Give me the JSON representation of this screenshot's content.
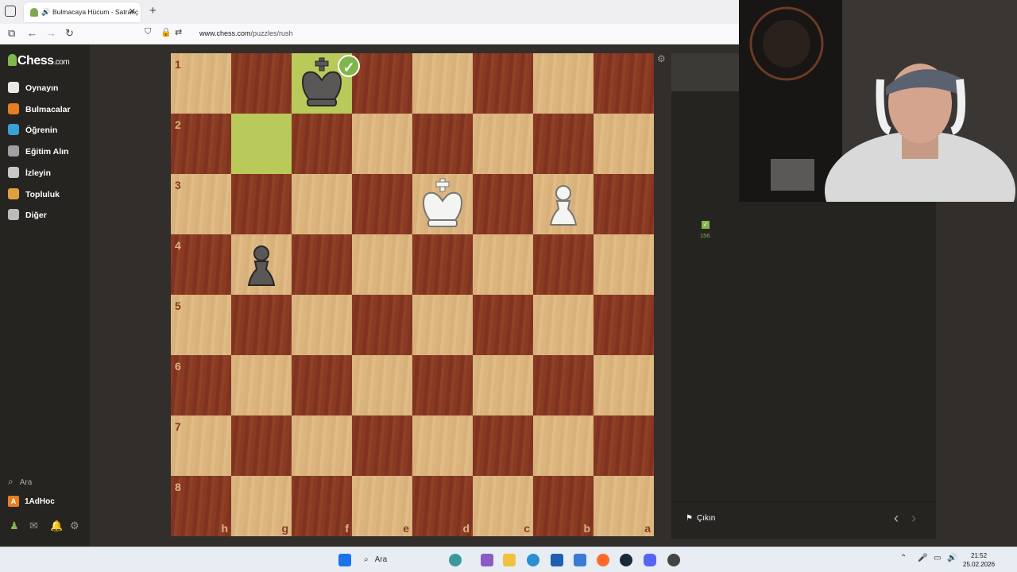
{
  "browser": {
    "tab_title": "Bulmacaya Hücum - Satranç",
    "url_host": "www.chess.com",
    "url_path": "/puzzles/rush"
  },
  "sidebar": {
    "logo": "Chess",
    "logo_suffix": ".com",
    "items": [
      {
        "label": "Oynayın",
        "icon": "play-icon",
        "color": "#e8e8e8"
      },
      {
        "label": "Bulmacalar",
        "icon": "puzzle-icon",
        "color": "#e67e22"
      },
      {
        "label": "Öğrenin",
        "icon": "learn-icon",
        "color": "#3aa0d8"
      },
      {
        "label": "Eğitim Alın",
        "icon": "coach-icon",
        "color": "#a0a0a0"
      },
      {
        "label": "İzleyin",
        "icon": "watch-icon",
        "color": "#c8c8c8"
      },
      {
        "label": "Topluluk",
        "icon": "community-icon",
        "color": "#e0a040"
      },
      {
        "label": "Diğer",
        "icon": "more-icon",
        "color": "#bbbbbb"
      }
    ],
    "search_label": "Ara",
    "username": "1AdHoc",
    "avatar_letter": "A"
  },
  "board": {
    "orientation": "black",
    "ranks": [
      "1",
      "2",
      "3",
      "4",
      "5",
      "6",
      "7",
      "8"
    ],
    "files": [
      "h",
      "g",
      "f",
      "e",
      "d",
      "c",
      "b",
      "a"
    ],
    "highlighted": [
      "f1",
      "g2"
    ],
    "pieces": [
      {
        "square": "f1",
        "type": "king",
        "color": "black"
      },
      {
        "square": "d3",
        "type": "king",
        "color": "white"
      },
      {
        "square": "b3",
        "type": "pawn",
        "color": "white"
      },
      {
        "square": "g4",
        "type": "pawn",
        "color": "black"
      }
    ],
    "move_status": "correct"
  },
  "panel": {
    "score": "156",
    "quit_label": "Çıkın"
  },
  "taskbar": {
    "search_label": "Ara",
    "time": "21:52",
    "date": "25.02.2026"
  }
}
